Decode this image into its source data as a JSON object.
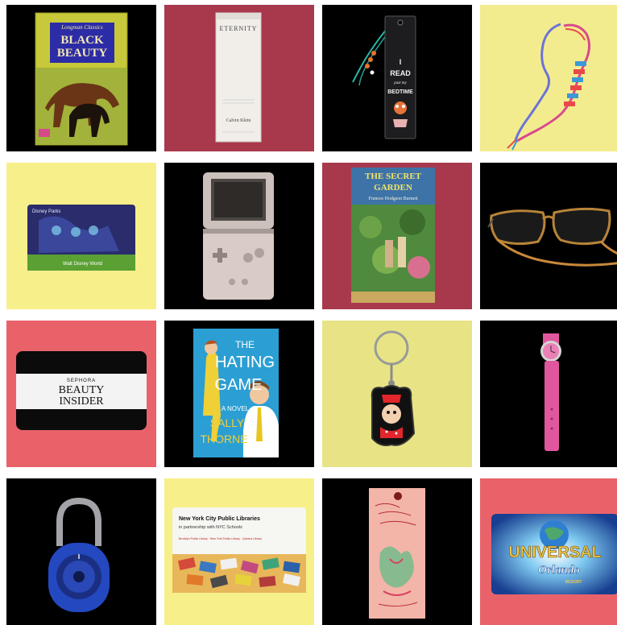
{
  "tiles": [
    {
      "item": "black-beauty-book",
      "background": "#000000",
      "texts": {
        "author": "Longman Classics",
        "title_line1": "BLACK",
        "title_line2": "BEAUTY"
      }
    },
    {
      "item": "eternity-perfume-box",
      "background": "#a8394c",
      "texts": {
        "brand_top": "ETERNITY",
        "brand_bottom": "Calvin Klein"
      }
    },
    {
      "item": "read-bookmark",
      "background": "#000000",
      "texts": {
        "line1": "I",
        "line2": "READ",
        "line3": "past my",
        "line4": "BEDTIME"
      }
    },
    {
      "item": "friendship-bracelet",
      "background": "#f3ec8f"
    },
    {
      "item": "disney-card",
      "background": "#f7ef8a",
      "texts": {
        "top": "Disney Parks",
        "bottom": "Walt Disney World"
      }
    },
    {
      "item": "game-boy-advance-sp",
      "background": "#000000"
    },
    {
      "item": "secret-garden-book",
      "background": "#a8394c",
      "texts": {
        "title_line1": "THE SECRET",
        "title_line2": "GARDEN",
        "author": "Frances Hodgson Burnett"
      }
    },
    {
      "item": "eyeglasses",
      "background": "#000000"
    },
    {
      "item": "sephora-card",
      "background": "#e9626a",
      "texts": {
        "brand": "SEPHORA",
        "line1": "BEAUTY",
        "line2": "INSIDER"
      }
    },
    {
      "item": "hating-game-book",
      "background": "#000000",
      "texts": {
        "line1": "THE",
        "line2": "HATING",
        "line3": "GAME",
        "line4": "A NOVEL",
        "author_line1": "SALLY",
        "author_line2": "THORNE"
      }
    },
    {
      "item": "minnie-keychain",
      "background": "#e8e486"
    },
    {
      "item": "pink-watch",
      "background": "#000000"
    },
    {
      "item": "combination-padlock",
      "background": "#000000"
    },
    {
      "item": "nyc-library-card",
      "background": "#f7ef8a",
      "texts": {
        "title": "New York City Public Libraries",
        "subtitle": "in partnership with NYC Schools",
        "footer": "Brooklyn Public Library · New York Public Library · Queens Library"
      }
    },
    {
      "item": "luggage-tag",
      "background": "#000000"
    },
    {
      "item": "universal-orlando-card",
      "background": "#e9626a",
      "texts": {
        "brand": "UNIVERSAL",
        "sub": "Orlando",
        "tag": "RESORT"
      }
    }
  ]
}
